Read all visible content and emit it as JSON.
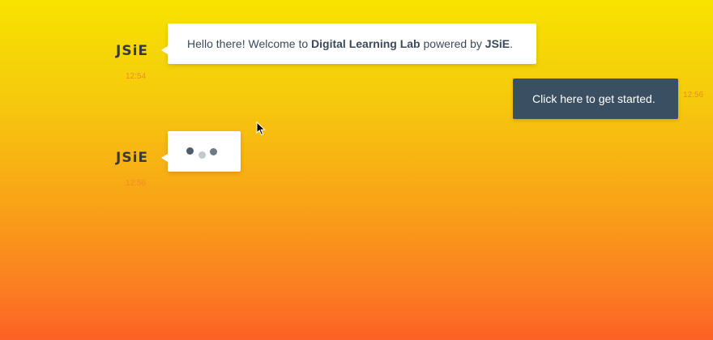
{
  "messages": [
    {
      "sender": "JSiE",
      "time": "12:54",
      "text_before": "Hello there! Welcome to ",
      "highlight1": "Digital Learning Lab",
      "text_middle": " powered by ",
      "highlight2": "JSiE",
      "text_after": "."
    },
    {
      "sender": "user",
      "time": "12:56",
      "text": "Click here to get started."
    },
    {
      "sender": "JSiE",
      "time": "12:56",
      "typing": true
    }
  ],
  "colors": {
    "bot_text": "#3b4a5c",
    "user_bubble": "#3b4f63",
    "timestamp": "#f08a2a"
  },
  "icons": {
    "typing": "typing-dots-icon",
    "cursor": "mouse-pointer-icon"
  }
}
